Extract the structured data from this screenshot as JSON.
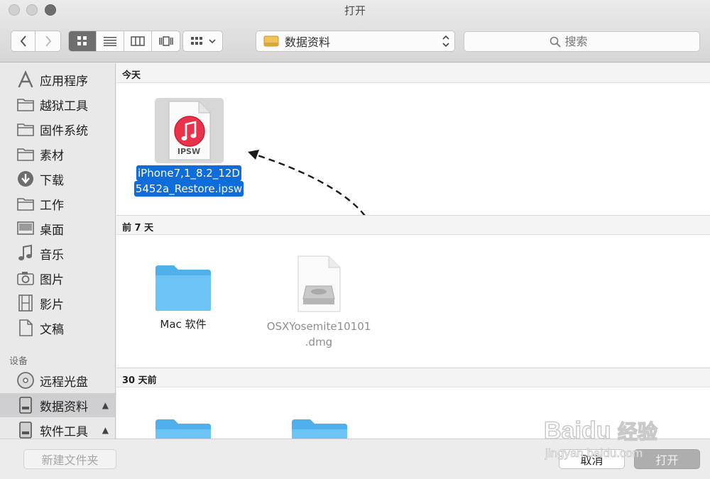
{
  "window": {
    "title": "打开"
  },
  "toolbar": {
    "path_label": "数据资料",
    "search_placeholder": "搜索"
  },
  "sidebar": {
    "favorites": [
      {
        "label": "应用程序",
        "icon": "applications-icon"
      },
      {
        "label": "越狱工具",
        "icon": "folder-icon"
      },
      {
        "label": "固件系统",
        "icon": "folder-icon"
      },
      {
        "label": "素材",
        "icon": "folder-icon"
      },
      {
        "label": "下载",
        "icon": "downloads-icon"
      },
      {
        "label": "工作",
        "icon": "folder-icon"
      },
      {
        "label": "桌面",
        "icon": "desktop-icon"
      },
      {
        "label": "音乐",
        "icon": "music-icon"
      },
      {
        "label": "图片",
        "icon": "camera-icon"
      },
      {
        "label": "影片",
        "icon": "film-icon"
      },
      {
        "label": "文稿",
        "icon": "documents-icon"
      }
    ],
    "devices_heading": "设备",
    "devices": [
      {
        "label": "远程光盘",
        "icon": "optical-disc-icon"
      },
      {
        "label": "数据资料",
        "icon": "hard-drive-icon",
        "selected": true,
        "ejectable": true
      },
      {
        "label": "软件工具",
        "icon": "hard-drive-icon",
        "ejectable": true
      }
    ]
  },
  "sections": [
    {
      "header": "今天",
      "files": [
        {
          "name_line1": "iPhone7,1_8.2_12D",
          "name_line2": "5452a_Restore.ipsw",
          "icon": "ipsw-file-icon",
          "icon_label": "IPSW",
          "selected": true
        }
      ]
    },
    {
      "header": "前 7 天",
      "files": [
        {
          "name_line1": "Mac 软件",
          "icon": "folder-icon"
        },
        {
          "name_line1": "OSXYosemite10101",
          "name_line2": ".dmg",
          "icon": "dmg-file-icon",
          "dimmed": true
        }
      ]
    },
    {
      "header": "30 天前",
      "files": [
        {
          "icon": "folder-icon"
        },
        {
          "icon": "folder-icon"
        }
      ]
    }
  ],
  "bottom_bar": {
    "new_folder_label": "新建文件夹",
    "cancel_label": "取消",
    "open_label": "打开"
  },
  "watermark": {
    "brand": "Bai",
    "brand2": "du",
    "cn": "经验",
    "url": "jingyan.baidu.com"
  },
  "colors": {
    "selection": "#0f6cdb",
    "folder": "#5db8f2"
  }
}
